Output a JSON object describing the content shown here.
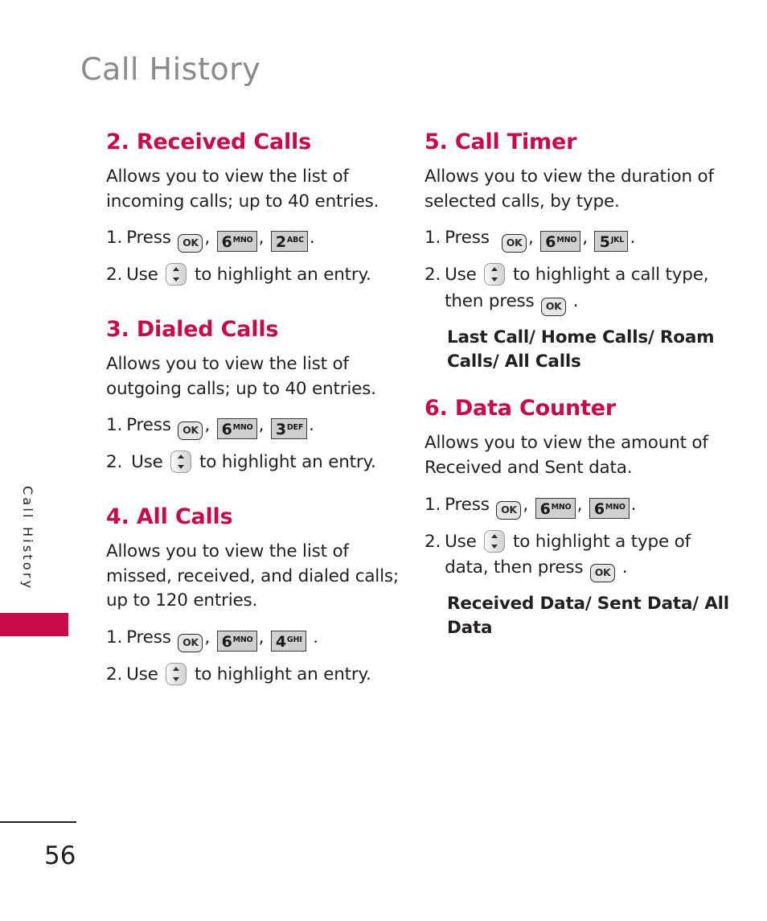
{
  "page": {
    "header_title": "Call History",
    "side_tab_label": "Call History",
    "page_number": "56",
    "accent_color": "#c8094b",
    "header_color": "#8a8a8a",
    "body_color": "#231f20"
  },
  "keys": {
    "ok": {
      "label": "OK",
      "name": "ok-key-icon"
    },
    "num6": {
      "digit": "6",
      "letters": "MNO"
    },
    "num5": {
      "digit": "5",
      "letters": "JKL"
    },
    "num4": {
      "digit": "4",
      "letters": "GHI"
    },
    "num3": {
      "digit": "3",
      "letters": "DEF"
    },
    "num2": {
      "digit": "2",
      "letters": "ABC"
    },
    "nav": {
      "name": "updown-navigation-key-icon"
    }
  },
  "left_column": {
    "sections": [
      {
        "title": "2. Received Calls",
        "description": "Allows you to view the list of incoming calls; up to 40 entries.",
        "steps": [
          {
            "num": "1.",
            "prefix": "Press",
            "keys": [
              "ok",
              "num6",
              "num2"
            ],
            "suffix": "."
          },
          {
            "num": "2.",
            "prefix": "Use",
            "keys": [
              "nav"
            ],
            "suffix": "to highlight an entry."
          }
        ]
      },
      {
        "title": "3. Dialed Calls",
        "description": "Allows you to view the list of outgoing calls; up to 40 entries.",
        "steps": [
          {
            "num": "1.",
            "prefix": "Press",
            "keys": [
              "ok",
              "num6",
              "num3"
            ],
            "suffix": "."
          },
          {
            "num": "2.",
            "prefix": "Use",
            "keys": [
              "nav"
            ],
            "suffix": "to highlight an entry."
          }
        ]
      },
      {
        "title": "4. All Calls",
        "description": "Allows you to view the list of missed, received, and dialed calls; up to 120 entries.",
        "steps": [
          {
            "num": "1.",
            "prefix": "Press",
            "keys": [
              "ok",
              "num6",
              "num4"
            ],
            "suffix": "."
          },
          {
            "num": "2.",
            "prefix": "Use",
            "keys": [
              "nav"
            ],
            "suffix": "to highlight an entry."
          }
        ]
      }
    ]
  },
  "right_column": {
    "sections": [
      {
        "title": "5. Call Timer",
        "description": "Allows you to view the duration of selected calls, by type.",
        "steps": [
          {
            "num": "1.",
            "prefix": "Press",
            "keys": [
              "ok",
              "num6",
              "num5"
            ],
            "suffix": "."
          },
          {
            "num": "2.",
            "prefix": "Use",
            "keys": [
              "nav"
            ],
            "mid": "to highlight a call type, then press",
            "keys2": [
              "ok"
            ],
            "suffix": "."
          }
        ],
        "options": "Last Call/ Home Calls/ Roam Calls/ All Calls"
      },
      {
        "title": "6. Data Counter",
        "description": "Allows you to view the amount of Received and Sent data.",
        "steps": [
          {
            "num": "1.",
            "prefix": "Press",
            "keys": [
              "ok",
              "num6",
              "num6"
            ],
            "suffix": "."
          },
          {
            "num": "2.",
            "prefix": "Use",
            "keys": [
              "nav"
            ],
            "mid": "to highlight a type of data, then press",
            "keys2": [
              "ok"
            ],
            "suffix": "."
          }
        ],
        "options": "Received Data/ Sent Data/ All Data"
      }
    ]
  }
}
